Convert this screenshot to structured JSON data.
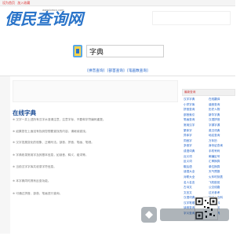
{
  "topbar": {
    "link1": "设为首页",
    "link2": "加入收藏"
  },
  "logo": {
    "text": "便民查询网",
    "domain": "www.bmcx.com"
  },
  "search": {
    "value": "字典"
  },
  "tabs": {
    "a": "[拼音查询]",
    "b": "[部首查询]",
    "c": "[笔画数查询]"
  },
  "main": {
    "title": "在线字典",
    "p1": "※ 汉字一并上述所有汉字水准请注意，注意字标、不要和字符编码重复。",
    "p2": "※ 如果您在上面没有找到您想要查找的内容，请继续查找。",
    "p3": "※ 汉字发展变化的现象、正确写法。部首、拼音、笔画、笔顺。",
    "p4": "※ 字典收录常用字及其基本信息，如读音、释义、组词等。",
    "p5": "※ 当前汉字字库共收录字符信息。",
    "p6": "※ 本字典同时具有反查功能。",
    "p7": "※ 可通过拼音、部首、笔画进行查询。"
  },
  "right": {
    "title": "最新查询",
    "col1": [
      "汉字字典",
      "小学字库",
      "拼音查询",
      "部首索引",
      "笔画查询",
      "常用汉字",
      "繁体字",
      "异体字",
      "同音字",
      "多音字",
      "成语词典",
      "近义词",
      "反义词",
      "歇后语",
      "谜语大全",
      "对联大全",
      "名人名言",
      "古诗文",
      "文言文",
      "汉语词典",
      "汉字笔顺",
      "读音查询",
      "字义查询"
    ],
    "col2": [
      "在线翻译",
      "谐音查询",
      "历史人物",
      "新华字典",
      "汉语拼音",
      "字源字源",
      "英汉词典",
      "地名查询",
      "万年历",
      "身份证查询",
      "手机号码",
      "邮编区号",
      "汇率换算",
      "单位换算",
      "天气预报",
      "火车时刻表",
      "飞机航班",
      "公交线路",
      "过光参考",
      "知识小百科",
      "学习资料",
      "经典名句",
      "常用工具"
    ]
  }
}
